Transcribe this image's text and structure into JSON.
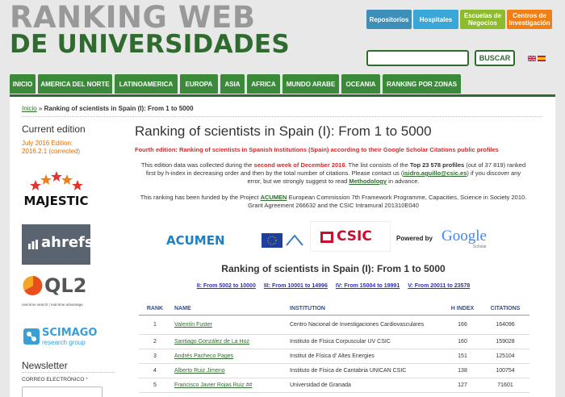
{
  "header": {
    "logo_line1": "RANKING WEB",
    "logo_line2": "DE UNIVERSIDADES",
    "top_links": [
      {
        "label": "Repositorios",
        "color": "#3d8fb7"
      },
      {
        "label": "Hospitales",
        "color": "#39a8d9"
      },
      {
        "label": "Escuelas de Negocios",
        "color": "#8dbb2d"
      },
      {
        "label": "Centros de Investigación",
        "color": "#f07f16"
      }
    ],
    "search_button": "BUSCAR"
  },
  "nav": [
    "INICIO",
    "AMERICA DEL NORTE",
    "LATINOAMERICA",
    "EUROPA",
    "ASIA",
    "AFRICA",
    "MUNDO ARABE",
    "OCEANIA",
    "RANKING POR ZONAS"
  ],
  "breadcrumb": {
    "home": "Inicio",
    "sep": " » ",
    "current": "Ranking of scientists in Spain (I): From 1 to 5000"
  },
  "sidebar": {
    "current_edition_title": "Current edition",
    "edition_line1": "July 2016 Edition:",
    "edition_line2": "2016.2.1 (corrected)",
    "badges": [
      "MAJESTIC",
      "ahrefs",
      "QL2",
      "real-time search | real-time advantage",
      "SCIMAGO",
      "research group"
    ],
    "newsletter_title": "Newsletter",
    "email_label": "CORREO ELECTRÓNICO",
    "required_mark": "*"
  },
  "content": {
    "title": "Ranking of scientists in Spain (I): From 1 to 5000",
    "subtitle": "Fourth edition: Ranking of scientists in Spanish Institutions (Spain) according to their Google Scholar Citations public profiles",
    "p1_a": "This edition data was collected during the ",
    "p1_b": "second week of December 2016",
    "p1_c": ". The list consists of the ",
    "p1_d": "Top 23 578 profiles",
    "p1_e": " (out of 37 819) ranked first by h-index in decreasing order and then by the total number of citations. Please contact us (",
    "p1_f": "isidro.aguillo@csic.es",
    "p1_g": ") if you discover any error, but we strongly suggest to read ",
    "p1_h": "Methodology",
    "p1_i": " in advance.",
    "p2_a": "This ranking has been funded by the Project ",
    "p2_b": "ACUMEN",
    "p2_c": " European Commission 7th Framework Programme, Capacities, Science in Society 2010. Grant Agreement 266632 and the CSIC Intramural 201310E040",
    "logos": [
      "ACUMEN",
      "CSIC",
      "Powered by",
      "Google",
      "Scholar"
    ],
    "table_title": "Ranking of scientists in Spain (I): From 1 to 5000",
    "ranges": [
      "II: From 5002 to 10000",
      "III: From 10001 to 14996",
      "IV: From 15004 to 19991",
      "V: From 20011 to 23578"
    ],
    "columns": [
      "RANK",
      "NAME",
      "INSTITUTION",
      "H INDEX",
      "CITATIONS"
    ],
    "rows": [
      {
        "rank": "1",
        "name": "Valentín Fuster",
        "institution": "Centro Nacional de Investigaciones Cardiovasculares",
        "h": "166",
        "cit": "164096"
      },
      {
        "rank": "2",
        "name": "Santiago González de La Hoz",
        "institution": "Instituto de Física Corpuscular UV CSIC",
        "h": "160",
        "cit": "159028"
      },
      {
        "rank": "3",
        "name": "Andrés Pacheco Pages",
        "institution": "Institut de Física d' Altes Energies",
        "h": "151",
        "cit": "125104"
      },
      {
        "rank": "4",
        "name": "Alberto Ruiz Jimeno",
        "institution": "Instituto de Física de Cantabria UNICAN CSIC",
        "h": "138",
        "cit": "100754"
      },
      {
        "rank": "5",
        "name": "Francisco Javier Rojas Ruiz ##",
        "institution": "Universidad de Granada",
        "h": "127",
        "cit": "71601"
      }
    ]
  }
}
